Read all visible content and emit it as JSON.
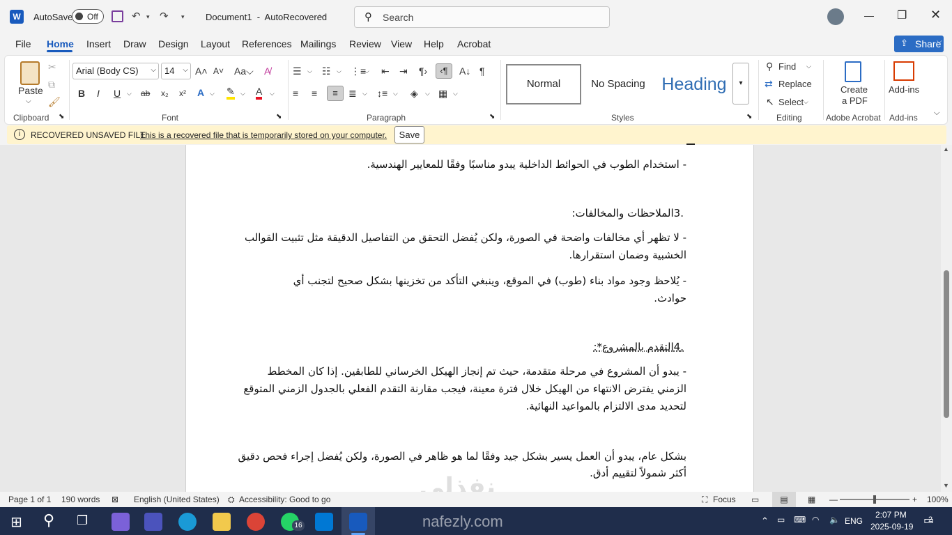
{
  "titlebar": {
    "autosave_label": "AutoSave",
    "autosave_state": "Off",
    "doc_title": "Document1  -  AutoRecovered",
    "search_placeholder": "Search"
  },
  "menu": [
    "File",
    "Home",
    "Insert",
    "Draw",
    "Design",
    "Layout",
    "References",
    "Mailings",
    "Review",
    "View",
    "Help",
    "Acrobat"
  ],
  "share_label": "Share",
  "ribbon": {
    "clipboard": {
      "paste": "Paste",
      "label": "Clipboard"
    },
    "font": {
      "name": "Arial (Body CS)",
      "size": "14",
      "label": "Font"
    },
    "paragraph": {
      "label": "Paragraph"
    },
    "styles": {
      "normal": "Normal",
      "nospacing": "No Spacing",
      "heading": "Heading",
      "label": "Styles"
    },
    "editing": {
      "find": "Find",
      "replace": "Replace",
      "select": "Select",
      "label": "Editing"
    },
    "acrobat": {
      "create": "Create",
      "pdf": "a PDF",
      "label": "Adobe Acrobat"
    },
    "addins": {
      "btn": "Add-ins",
      "label": "Add-ins"
    }
  },
  "recovered": {
    "title": "RECOVERED UNSAVED FILE",
    "message": "This is a recovered file that is temporarily stored on your computer.",
    "save": "Save"
  },
  "document": {
    "lines": [
      "-   استخدام الطوب في الحوائط الداخلية يبدو مناسبًا وفقًا للمعايير الهندسية.",
      ".3الملاحظات والمخالفات:",
      "-  لا تظهر أي مخالفات واضحة في الصورة، ولكن يُفضل التحقق من التفاصيل الدقيقة مثل تثبيت القوالب",
      "الخشبية وضمان استقرارها.",
      "-  يُلاحظ وجود مواد بناء (طوب) في الموقع، وينبغي التأكد من تخزينها بشكل صحيح لتجنب أي",
      "حوادث.",
      ".4التقدم بالمشروع*:",
      "-  يبدو أن المشروع في مرحلة متقدمة، حيث تم إنجاز الهيكل الخرساني للطابقين. إذا كان المخطط",
      "الزمني يفترض الانتهاء من الهيكل خلال فترة معينة، فيجب مقارنة التقدم الفعلي بالجدول الزمني المتوقع",
      "لتحديد مدى الالتزام بالمواعيد النهائية.",
      "بشكل عام، يبدو أن العمل يسير بشكل جيد وفقًا لما هو ظاهر في الصورة، ولكن يُفضل إجراء فحص دقيق",
      "أكثر شمولاً لتقييم أدق."
    ]
  },
  "status": {
    "page": "Page 1 of 1",
    "words": "190 words",
    "language": "English (United States)",
    "accessibility": "Accessibility: Good to go",
    "focus": "Focus",
    "zoom": "100%"
  },
  "watermark": {
    "arabic": "نفذلي",
    "url": "nafezly.com"
  },
  "taskbar": {
    "whatsapp_badge": "16",
    "lang": "ENG",
    "time": "2:07 PM",
    "date": "2025-09-19",
    "notif": "2"
  }
}
